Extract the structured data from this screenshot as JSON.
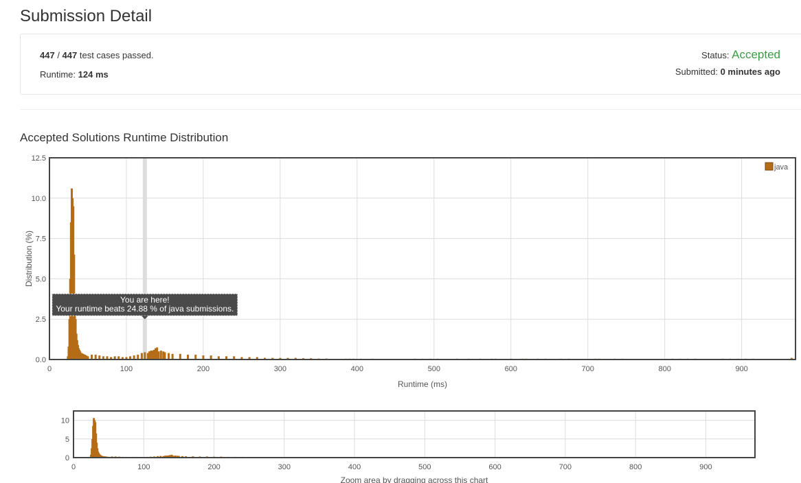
{
  "page": {
    "title": "Submission Detail"
  },
  "detail": {
    "passed": "447",
    "slash": " / ",
    "total": "447",
    "passed_suffix": " test cases passed.",
    "runtime_label": "Runtime: ",
    "runtime_value": "124 ms",
    "status_label": "Status: ",
    "status_value": "Accepted",
    "submitted_label": "Submitted: ",
    "submitted_value": "0 minutes ago",
    "status_color": "#3c9a43"
  },
  "section": {
    "title": "Accepted Solutions Runtime Distribution"
  },
  "chart_data": {
    "type": "bar",
    "xlabel": "Runtime (ms)",
    "ylabel": "Distribution (%)",
    "xlim": [
      0,
      970
    ],
    "ylim": [
      0,
      12.5
    ],
    "x_ticks": [
      0,
      100,
      200,
      300,
      400,
      500,
      600,
      700,
      800,
      900
    ],
    "y_ticks": [
      "0.0",
      "2.5",
      "5.0",
      "7.5",
      "10.0",
      "12.5"
    ],
    "grid": true,
    "legend_position": "top-right",
    "bar_color": "#b46c16",
    "highlight_x": 124,
    "tooltip": {
      "title": "You are here!",
      "text": "Your runtime beats 24.88 % of java submissions."
    },
    "series": [
      {
        "name": "java",
        "x": [
          24,
          25,
          26,
          27,
          28,
          29,
          30,
          31,
          32,
          33,
          34,
          35,
          36,
          37,
          38,
          39,
          40,
          42,
          44,
          46,
          48,
          50,
          55,
          60,
          65,
          70,
          75,
          80,
          85,
          90,
          95,
          100,
          105,
          110,
          115,
          120,
          124,
          128,
          130,
          132,
          134,
          136,
          138,
          140,
          142,
          145,
          148,
          150,
          155,
          160,
          170,
          180,
          190,
          200,
          210,
          220,
          230,
          240,
          250,
          260,
          270,
          280,
          290,
          300,
          310,
          320,
          330,
          340,
          350,
          360,
          385,
          390,
          395,
          405,
          420,
          475,
          485,
          495,
          505,
          530,
          545,
          560,
          575,
          580,
          600,
          615,
          620,
          635,
          645,
          665,
          675,
          710,
          715,
          735,
          745,
          810,
          820,
          830,
          840,
          875,
          885,
          895,
          905,
          915,
          965
        ],
        "values": [
          0.2,
          0.8,
          2.5,
          5.0,
          8.5,
          10.6,
          10.0,
          9.5,
          6.5,
          4.0,
          2.5,
          1.6,
          1.2,
          0.9,
          0.7,
          0.6,
          0.5,
          0.4,
          0.35,
          0.3,
          0.25,
          0.2,
          0.3,
          0.3,
          0.25,
          0.2,
          0.2,
          0.15,
          0.2,
          0.2,
          0.15,
          0.15,
          0.2,
          0.25,
          0.3,
          0.4,
          0.45,
          0.4,
          0.5,
          0.55,
          0.55,
          0.6,
          0.7,
          0.75,
          0.5,
          0.55,
          0.5,
          0.45,
          0.4,
          0.35,
          0.35,
          0.3,
          0.3,
          0.25,
          0.25,
          0.2,
          0.2,
          0.2,
          0.15,
          0.15,
          0.15,
          0.1,
          0.1,
          0.1,
          0.1,
          0.1,
          0.08,
          0.08,
          0.06,
          0.06,
          0.05,
          0.05,
          0.05,
          0.05,
          0.05,
          0.05,
          0.05,
          0.05,
          0.05,
          0.05,
          0.05,
          0.05,
          0.05,
          0.05,
          0.05,
          0.05,
          0.05,
          0.05,
          0.05,
          0.05,
          0.05,
          0.05,
          0.05,
          0.05,
          0.05,
          0.05,
          0.05,
          0.05,
          0.05,
          0.05,
          0.05,
          0.05,
          0.05,
          0.05,
          0.1
        ]
      }
    ],
    "overview": {
      "ylim": [
        0,
        12.5
      ],
      "y_ticks": [
        "0",
        "5",
        "10"
      ],
      "x_ticks": [
        0,
        100,
        200,
        300,
        400,
        500,
        600,
        700,
        800,
        900
      ],
      "caption": "Zoom area by dragging across this chart"
    }
  }
}
